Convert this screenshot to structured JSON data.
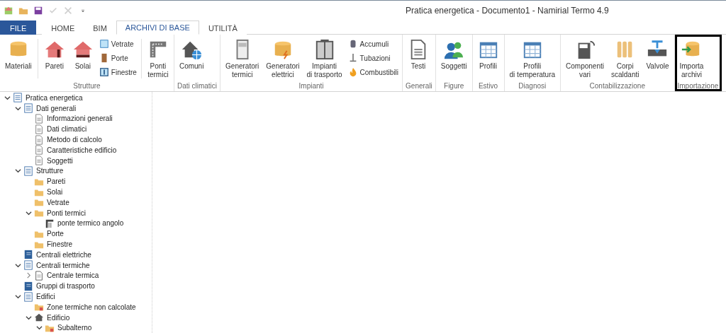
{
  "window": {
    "title": "Pratica energetica - Documento1 - Namirial Termo 4.9"
  },
  "quick_access": [
    {
      "kind": "app",
      "disabled": false
    },
    {
      "kind": "open",
      "disabled": false
    },
    {
      "kind": "save",
      "disabled": false
    },
    {
      "kind": "check",
      "disabled": true
    },
    {
      "kind": "cancel",
      "disabled": true
    },
    {
      "kind": "more",
      "disabled": false
    }
  ],
  "tabs": [
    {
      "label": "FILE",
      "kind": "file",
      "selected": false
    },
    {
      "label": "HOME",
      "kind": "tab",
      "selected": false
    },
    {
      "label": "BIM",
      "kind": "tab",
      "selected": false
    },
    {
      "label": "ARCHIVI DI BASE",
      "kind": "tab",
      "selected": true
    },
    {
      "label": "UTILITÀ",
      "kind": "tab",
      "selected": false
    }
  ],
  "ribbon": [
    {
      "label": "Strutture",
      "highlighted": false,
      "items": [
        {
          "kind": "large",
          "label": "Materiali"
        },
        {
          "kind": "separator"
        },
        {
          "kind": "large",
          "label": "Pareti"
        },
        {
          "kind": "large",
          "label": "Solai"
        },
        {
          "kind": "stack",
          "items": [
            {
              "label": "Vetrate"
            },
            {
              "label": "Porte"
            },
            {
              "label": "Finestre"
            }
          ]
        },
        {
          "kind": "separator"
        },
        {
          "kind": "large",
          "label": "Ponti termici"
        }
      ]
    },
    {
      "label": "Dati climatici",
      "highlighted": false,
      "items": [
        {
          "kind": "large",
          "label": "Comuni"
        }
      ]
    },
    {
      "label": "Impianti",
      "highlighted": false,
      "items": [
        {
          "kind": "large",
          "label": "Generatori termici"
        },
        {
          "kind": "large",
          "label": "Generatori elettrici"
        },
        {
          "kind": "large",
          "label": "Impianti di trasporto"
        },
        {
          "kind": "stack",
          "items": [
            {
              "label": "Accumuli"
            },
            {
              "label": "Tubazioni"
            },
            {
              "label": "Combustibili"
            }
          ]
        }
      ]
    },
    {
      "label": "Generali",
      "highlighted": false,
      "items": [
        {
          "kind": "large",
          "label": "Testi"
        }
      ]
    },
    {
      "label": "Figure",
      "highlighted": false,
      "items": [
        {
          "kind": "large",
          "label": "Soggetti"
        }
      ]
    },
    {
      "label": "Estivo",
      "highlighted": false,
      "items": [
        {
          "kind": "large",
          "label": "Profili"
        }
      ]
    },
    {
      "label": "Diagnosi",
      "highlighted": false,
      "items": [
        {
          "kind": "large",
          "label": "Profili di temperatura"
        }
      ]
    },
    {
      "label": "Contabilizzazione",
      "highlighted": false,
      "items": [
        {
          "kind": "large",
          "label": "Componenti vari"
        },
        {
          "kind": "large",
          "label": "Corpi scaldanti"
        },
        {
          "kind": "large",
          "label": "Valvole"
        }
      ]
    },
    {
      "label": "Importazione",
      "highlighted": true,
      "items": [
        {
          "kind": "large",
          "label": "Importa archivi"
        }
      ]
    }
  ],
  "tree": [
    {
      "label": "Pratica energetica",
      "kind": "list",
      "expanded": true,
      "children": [
        {
          "label": "Dati generali",
          "kind": "list",
          "expanded": true,
          "children": [
            {
              "label": "Informazioni generali",
              "kind": "document"
            },
            {
              "label": "Dati climatici",
              "kind": "document"
            },
            {
              "label": "Metodo di calcolo",
              "kind": "document"
            },
            {
              "label": "Caratteristiche edificio",
              "kind": "document"
            },
            {
              "label": "Soggetti",
              "kind": "document"
            }
          ]
        },
        {
          "label": "Strutture",
          "kind": "list",
          "expanded": true,
          "children": [
            {
              "label": "Pareti",
              "kind": "folder"
            },
            {
              "label": "Solai",
              "kind": "folder"
            },
            {
              "label": "Vetrate",
              "kind": "folder"
            },
            {
              "label": "Ponti termici",
              "kind": "folder",
              "expanded": true,
              "children": [
                {
                  "label": "ponte termico angolo",
                  "kind": "bridge"
                }
              ]
            },
            {
              "label": "Porte",
              "kind": "folder"
            },
            {
              "label": "Finestre",
              "kind": "folder"
            }
          ]
        },
        {
          "label": "Centrali elettriche",
          "kind": "book"
        },
        {
          "label": "Centrali termiche",
          "kind": "list",
          "expanded": true,
          "children": [
            {
              "label": "Centrale termica",
              "kind": "page",
              "expanded": false
            }
          ]
        },
        {
          "label": "Gruppi di trasporto",
          "kind": "book"
        },
        {
          "label": "Edifici",
          "kind": "list",
          "expanded": true,
          "children": [
            {
              "label": "Zone termiche non calcolate",
              "kind": "zone"
            },
            {
              "label": "Edificio",
              "kind": "house",
              "expanded": true,
              "children": [
                {
                  "label": "Subalterno",
                  "kind": "zone",
                  "expanded": true
                }
              ]
            }
          ]
        }
      ]
    }
  ]
}
